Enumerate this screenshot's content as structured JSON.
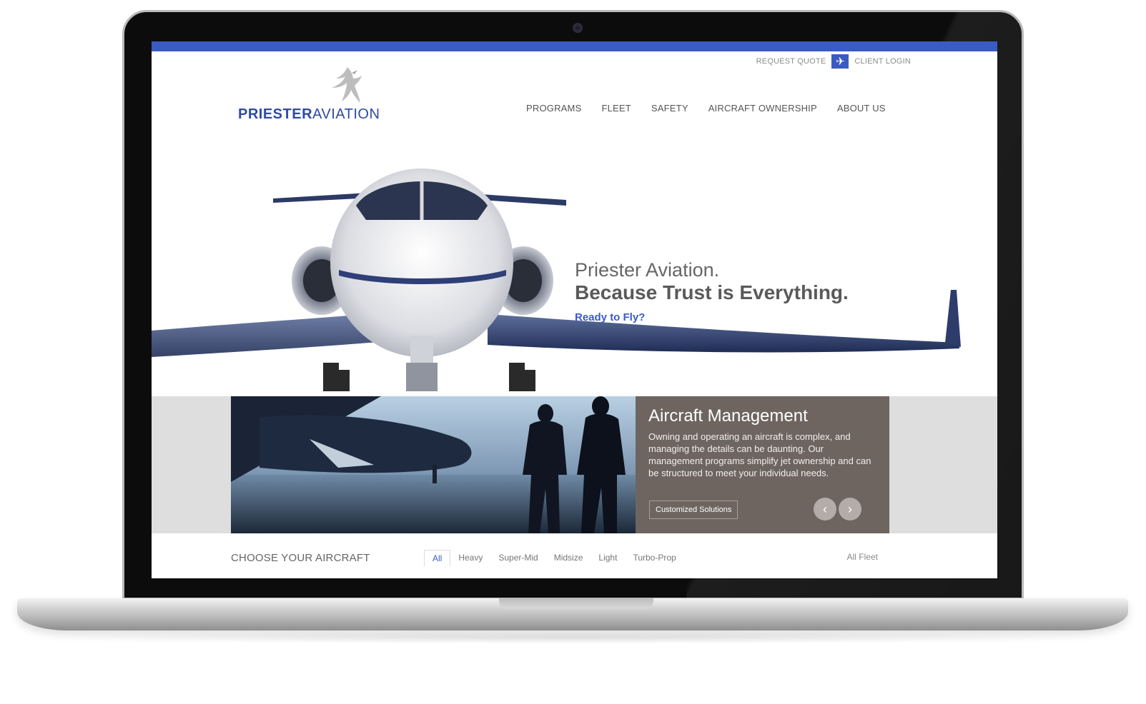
{
  "site": {
    "brand_primary": "PRIESTER",
    "brand_secondary": "AVIATION",
    "accent_color": "#3a5bc3"
  },
  "utility": {
    "request_quote": "REQUEST QUOTE",
    "plane_icon": "airplane-icon",
    "client_login": "CLIENT LOGIN"
  },
  "nav": {
    "items": [
      {
        "label": "PROGRAMS"
      },
      {
        "label": "FLEET"
      },
      {
        "label": "SAFETY"
      },
      {
        "label": "AIRCRAFT OWNERSHIP"
      },
      {
        "label": "ABOUT US"
      }
    ]
  },
  "hero": {
    "line1": "Priester Aviation.",
    "line2": "Because Trust is Everything.",
    "cta": "Ready to Fly?"
  },
  "banner": {
    "title": "Aircraft Management",
    "body": "Owning and operating an aircraft is complex, and managing the details can be daunting. Our management programs simplify jet ownership and can be structured to meet your individual needs.",
    "button": "Customized Solutions",
    "prev_icon": "chevron-left-icon",
    "next_icon": "chevron-right-icon"
  },
  "choose": {
    "title": "CHOOSE YOUR AIRCRAFT",
    "tabs": [
      {
        "label": "All",
        "active": true
      },
      {
        "label": "Heavy",
        "active": false
      },
      {
        "label": "Super-Mid",
        "active": false
      },
      {
        "label": "Midsize",
        "active": false
      },
      {
        "label": "Light",
        "active": false
      },
      {
        "label": "Turbo-Prop",
        "active": false
      }
    ],
    "all_fleet": "All Fleet"
  }
}
